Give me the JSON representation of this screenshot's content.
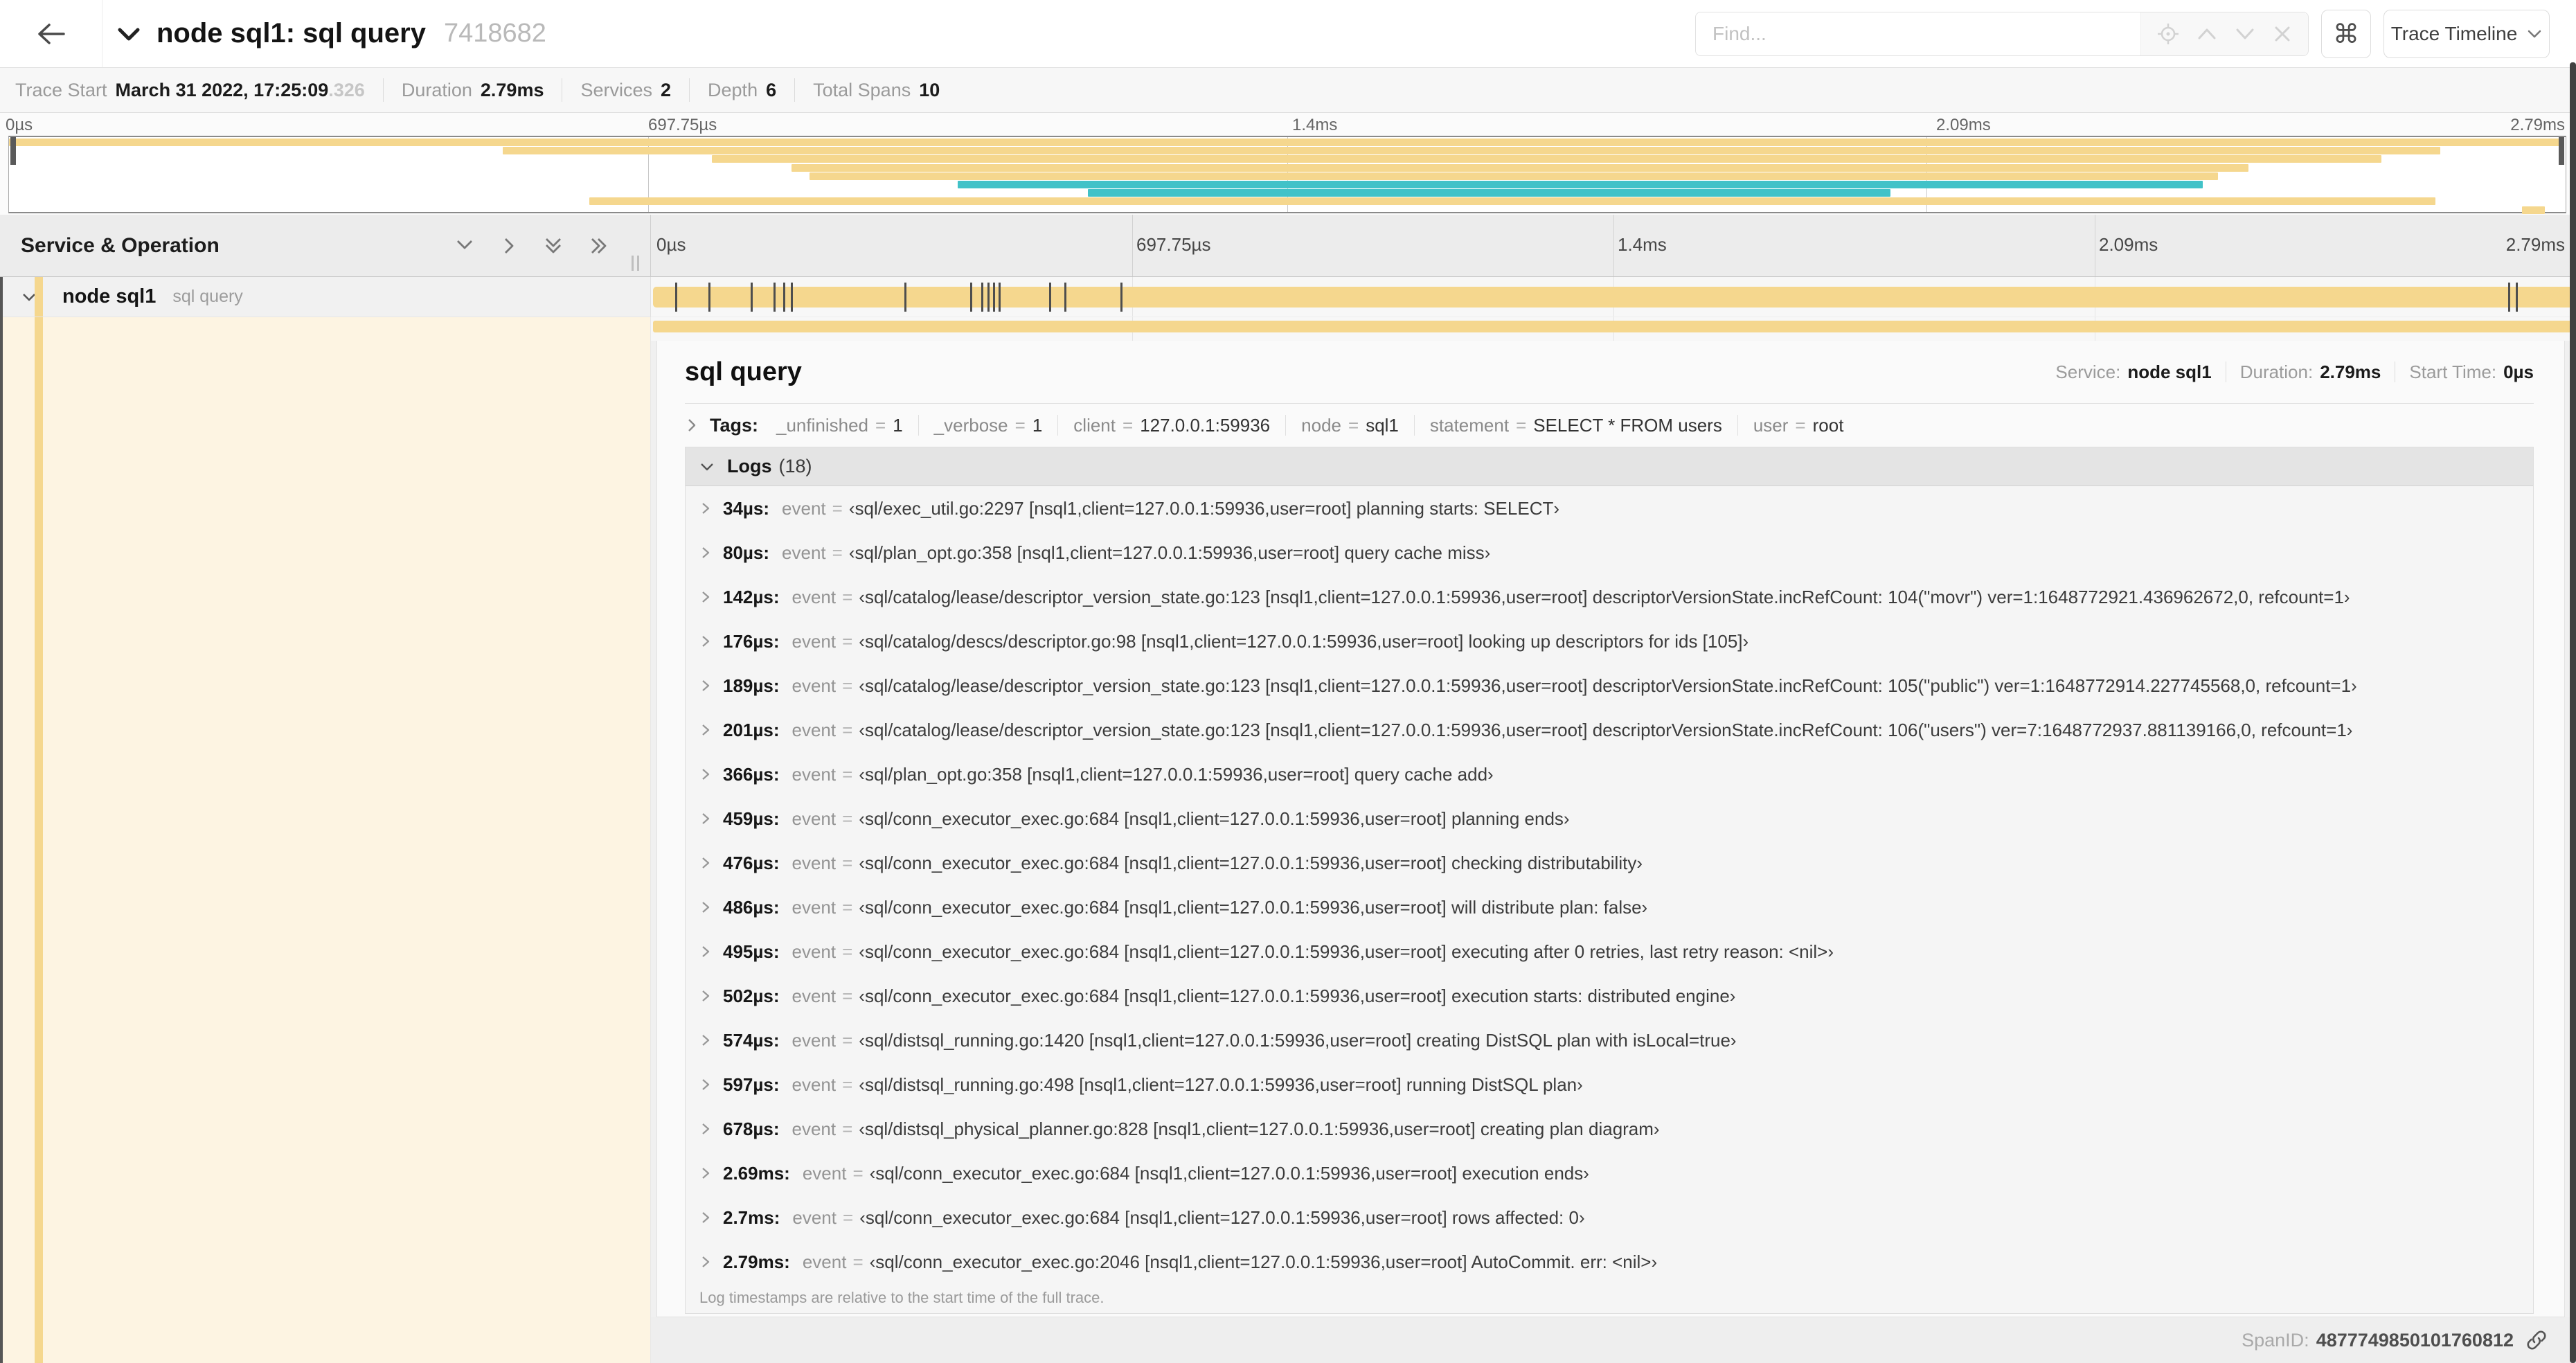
{
  "header": {
    "title": "node sql1: sql query",
    "trace_id": "7418682",
    "find_placeholder": "Find...",
    "view_selector_label": "Trace Timeline"
  },
  "trace_info": {
    "items": [
      {
        "label": "Trace Start",
        "value": "March 31 2022, 17:25:09",
        "suffix": ".326"
      },
      {
        "label": "Duration",
        "value": "2.79ms"
      },
      {
        "label": "Services",
        "value": "2"
      },
      {
        "label": "Depth",
        "value": "6"
      },
      {
        "label": "Total Spans",
        "value": "10"
      }
    ]
  },
  "colors": {
    "tan": "#F5D78E",
    "teal": "#41C2C8",
    "cream": "#FDF4E2"
  },
  "minimap": {
    "ticks": [
      "0µs",
      "697.75µs",
      "1.4ms",
      "2.09ms",
      "2.79ms"
    ],
    "rows": [
      {
        "start": 0,
        "end": 99.9,
        "color": "tan"
      },
      {
        "start": 19.3,
        "end": 95.1,
        "color": "tan"
      },
      {
        "start": 27.5,
        "end": 92.8,
        "color": "tan"
      },
      {
        "start": 30.6,
        "end": 87.6,
        "color": "tan"
      },
      {
        "start": 31.3,
        "end": 86.4,
        "color": "tan"
      },
      {
        "start": 37.1,
        "end": 85.8,
        "color": "teal"
      },
      {
        "start": 42.2,
        "end": 73.6,
        "color": "teal"
      },
      {
        "start": 22.7,
        "end": 94.9,
        "color": "tan"
      },
      {
        "start": 98.3,
        "end": 99.2,
        "color": "tan"
      }
    ]
  },
  "timeline": {
    "left_header": "Service & Operation",
    "ticks": [
      "0µs",
      "697.75µs",
      "1.4ms",
      "2.09ms",
      "2.79ms"
    ],
    "row": {
      "service": "node sql1",
      "operation": "sql query"
    },
    "log_marker_pct": [
      1.2,
      2.9,
      5.1,
      6.3,
      6.8,
      7.2,
      13.1,
      16.5,
      17.1,
      17.4,
      17.7,
      18.0,
      20.6,
      21.4,
      24.3,
      96.4,
      96.8,
      99.8
    ]
  },
  "detail": {
    "title": "sql query",
    "service_label": "Service:",
    "service_value": "node sql1",
    "duration_label": "Duration:",
    "duration_value": "2.79ms",
    "start_label": "Start Time:",
    "start_value": "0µs",
    "tags_label": "Tags:",
    "tags": [
      {
        "key": "_unfinished",
        "value": "1"
      },
      {
        "key": "_verbose",
        "value": "1"
      },
      {
        "key": "client",
        "value": "127.0.0.1:59936"
      },
      {
        "key": "node",
        "value": "sql1"
      },
      {
        "key": "statement",
        "value": "SELECT * FROM users"
      },
      {
        "key": "user",
        "value": "root"
      }
    ],
    "logs_label": "Logs",
    "logs_count_text": "(18)",
    "log_field_key": "event",
    "logs": [
      {
        "time": "34µs:",
        "msg": "‹sql/exec_util.go:2297 [nsql1,client=127.0.0.1:59936,user=root] planning starts: SELECT›"
      },
      {
        "time": "80µs:",
        "msg": "‹sql/plan_opt.go:358 [nsql1,client=127.0.0.1:59936,user=root] query cache miss›"
      },
      {
        "time": "142µs:",
        "msg": "‹sql/catalog/lease/descriptor_version_state.go:123 [nsql1,client=127.0.0.1:59936,user=root] descriptorVersionState.incRefCount: 104(\"movr\") ver=1:1648772921.436962672,0, refcount=1›"
      },
      {
        "time": "176µs:",
        "msg": "‹sql/catalog/descs/descriptor.go:98 [nsql1,client=127.0.0.1:59936,user=root] looking up descriptors for ids [105]›"
      },
      {
        "time": "189µs:",
        "msg": "‹sql/catalog/lease/descriptor_version_state.go:123 [nsql1,client=127.0.0.1:59936,user=root] descriptorVersionState.incRefCount: 105(\"public\") ver=1:1648772914.227745568,0, refcount=1›"
      },
      {
        "time": "201µs:",
        "msg": "‹sql/catalog/lease/descriptor_version_state.go:123 [nsql1,client=127.0.0.1:59936,user=root] descriptorVersionState.incRefCount: 106(\"users\") ver=7:1648772937.881139166,0, refcount=1›"
      },
      {
        "time": "366µs:",
        "msg": "‹sql/plan_opt.go:358 [nsql1,client=127.0.0.1:59936,user=root] query cache add›"
      },
      {
        "time": "459µs:",
        "msg": "‹sql/conn_executor_exec.go:684 [nsql1,client=127.0.0.1:59936,user=root] planning ends›"
      },
      {
        "time": "476µs:",
        "msg": "‹sql/conn_executor_exec.go:684 [nsql1,client=127.0.0.1:59936,user=root] checking distributability›"
      },
      {
        "time": "486µs:",
        "msg": "‹sql/conn_executor_exec.go:684 [nsql1,client=127.0.0.1:59936,user=root] will distribute plan: false›"
      },
      {
        "time": "495µs:",
        "msg": "‹sql/conn_executor_exec.go:684 [nsql1,client=127.0.0.1:59936,user=root] executing after 0 retries, last retry reason: <nil>›"
      },
      {
        "time": "502µs:",
        "msg": "‹sql/conn_executor_exec.go:684 [nsql1,client=127.0.0.1:59936,user=root] execution starts: distributed engine›"
      },
      {
        "time": "574µs:",
        "msg": "‹sql/distsql_running.go:1420 [nsql1,client=127.0.0.1:59936,user=root] creating DistSQL plan with isLocal=true›"
      },
      {
        "time": "597µs:",
        "msg": "‹sql/distsql_running.go:498 [nsql1,client=127.0.0.1:59936,user=root] running DistSQL plan›"
      },
      {
        "time": "678µs:",
        "msg": "‹sql/distsql_physical_planner.go:828 [nsql1,client=127.0.0.1:59936,user=root] creating plan diagram›"
      },
      {
        "time": "2.69ms:",
        "msg": "‹sql/conn_executor_exec.go:684 [nsql1,client=127.0.0.1:59936,user=root] execution ends›"
      },
      {
        "time": "2.7ms:",
        "msg": "‹sql/conn_executor_exec.go:684 [nsql1,client=127.0.0.1:59936,user=root] rows affected: 0›"
      },
      {
        "time": "2.79ms:",
        "msg": "‹sql/conn_executor_exec.go:2046 [nsql1,client=127.0.0.1:59936,user=root] AutoCommit. err: <nil>›"
      }
    ],
    "logs_note": "Log timestamps are relative to the start time of the full trace.",
    "span_id_label": "SpanID:",
    "span_id": "4877749850101760812"
  }
}
